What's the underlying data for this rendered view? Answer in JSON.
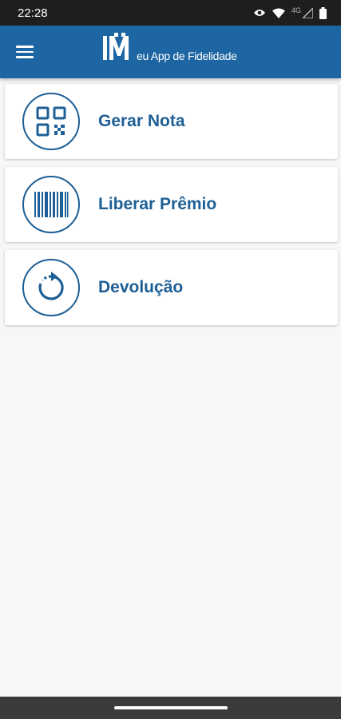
{
  "status_bar": {
    "time": "22:28",
    "network": "4G",
    "icons": [
      "eye-icon",
      "wifi-icon",
      "signal-icon",
      "battery-icon"
    ]
  },
  "app_bar": {
    "menu_icon": "hamburger-menu-icon",
    "logo_text": "eu App de Fidelidade",
    "background_color": "#1d66a3"
  },
  "menu": {
    "items": [
      {
        "label": "Gerar Nota",
        "icon": "qr-code-icon"
      },
      {
        "label": "Liberar Prêmio",
        "icon": "barcode-icon"
      },
      {
        "label": "Devolução",
        "icon": "refresh-icon"
      }
    ],
    "accent_color": "#1d5f96"
  }
}
